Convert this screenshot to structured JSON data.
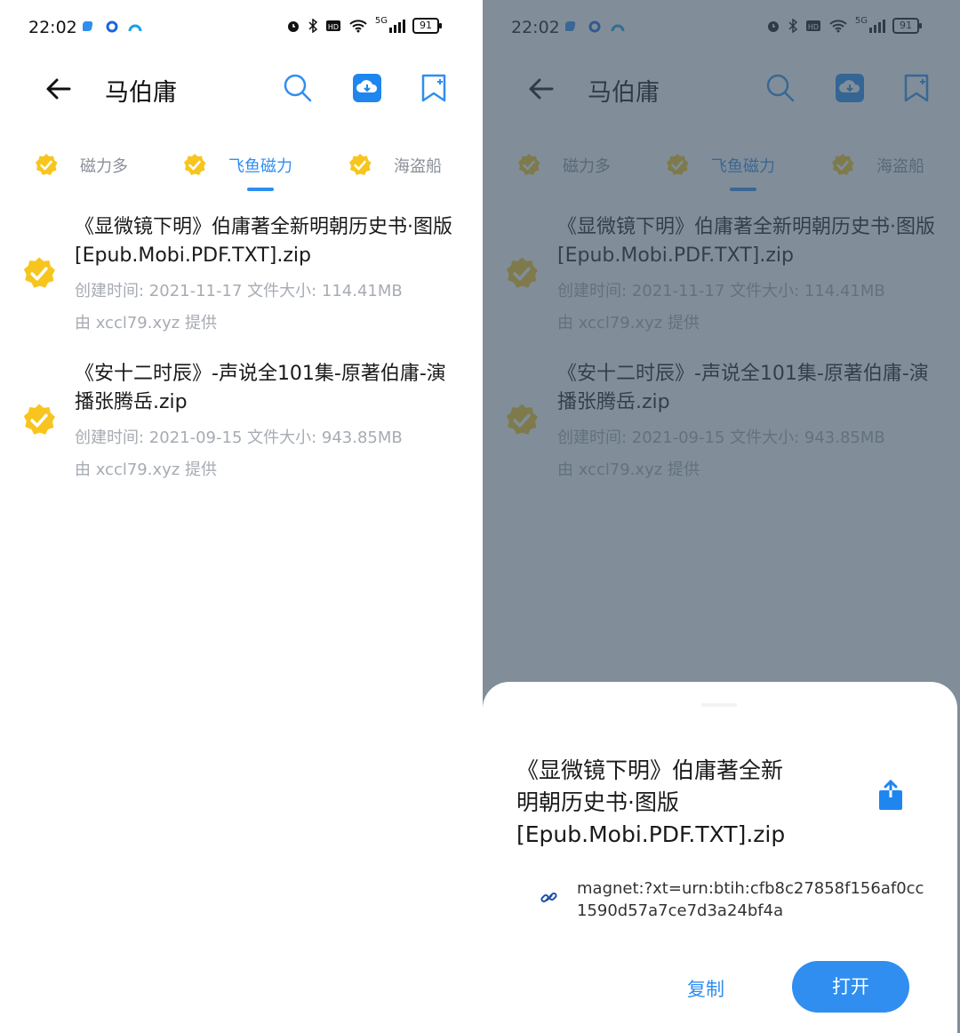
{
  "status_bar": {
    "time": "22:02",
    "network": "5G",
    "battery": "91"
  },
  "app_bar": {
    "title": "马伯庸"
  },
  "tabs": [
    {
      "label": "磁力多"
    },
    {
      "label": "飞鱼磁力"
    },
    {
      "label": "海盗船"
    }
  ],
  "results": [
    {
      "name": "《显微镜下明》伯庸著全新明朝历史书·图版[Epub.Mobi.PDF.TXT].zip",
      "meta": "创建时间: 2021-11-17 文件大小: 114.41MB",
      "source": "由 xccl79.xyz 提供"
    },
    {
      "name": "《安十二时辰》-声说全101集-原著伯庸-演播张腾岳.zip",
      "meta": "创建时间: 2021-09-15 文件大小: 943.85MB",
      "source": "由 xccl79.xyz 提供"
    }
  ],
  "sheet": {
    "title": "《显微镜下明》伯庸著全新明朝历史书·图版[Epub.Mobi.PDF.TXT].zip",
    "magnet": "magnet:?xt=urn:btih:cfb8c27858f156af0cc1590d57a7ce7d3a24bf4a",
    "copy_label": "复制",
    "open_label": "打开"
  },
  "colors": {
    "accent": "#2f8ef0",
    "badge": "#f7c51e",
    "overlay": "#3f5464"
  }
}
